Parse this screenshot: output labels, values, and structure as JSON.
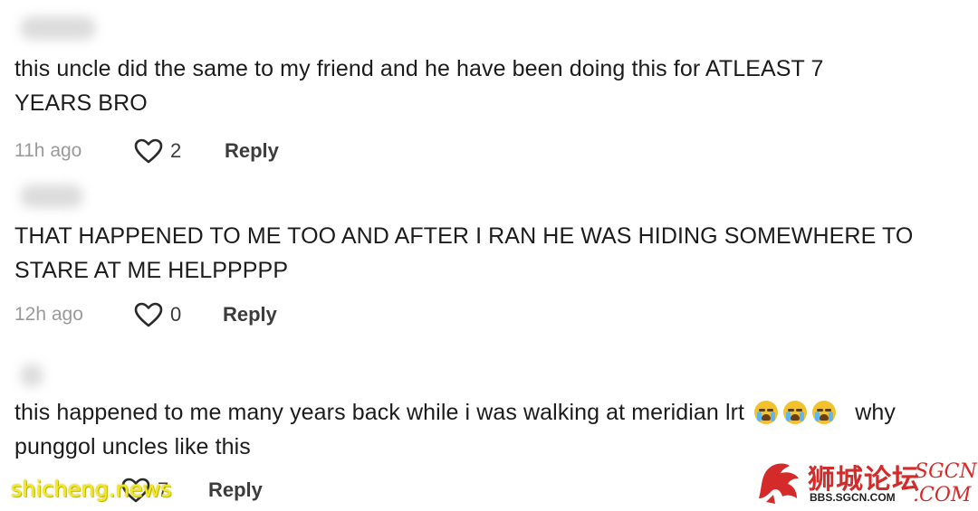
{
  "comments": [
    {
      "text_line1": "this uncle did the same to my friend and he have been doing this for ATLEAST 7",
      "text_line2": "YEARS BRO",
      "time": "11h ago",
      "likes": "2",
      "reply_label": "Reply"
    },
    {
      "text_line1": "THAT HAPPENED TO ME TOO AND AFTER I RAN HE WAS HIDING SOMEWHERE TO",
      "text_line2": "STARE AT ME HELPPPPP",
      "time": "12h ago",
      "likes": "0",
      "reply_label": "Reply"
    },
    {
      "text_line1_a": "this happened to me many years back while i was walking at meridian lrt",
      "text_line1_b": "why",
      "text_line2": "punggol uncles like this",
      "time": "",
      "likes": "7",
      "reply_label": "Reply",
      "emojis": [
        "loudly-crying-face",
        "loudly-crying-face",
        "loudly-crying-face"
      ]
    }
  ],
  "watermark": {
    "left_text": "shicheng.news",
    "brand_cn": "狮城论坛",
    "brand_url": "BBS.SGCN.COM",
    "brand_script_top": "SGCN",
    "brand_script_bottom": ".COM"
  },
  "colors": {
    "text": "#1c1c1c",
    "muted": "#9a9a9a",
    "reply": "#3c3c3c",
    "watermark_yellow": "#f2ea1e",
    "brand_red": "#d42a2a"
  }
}
